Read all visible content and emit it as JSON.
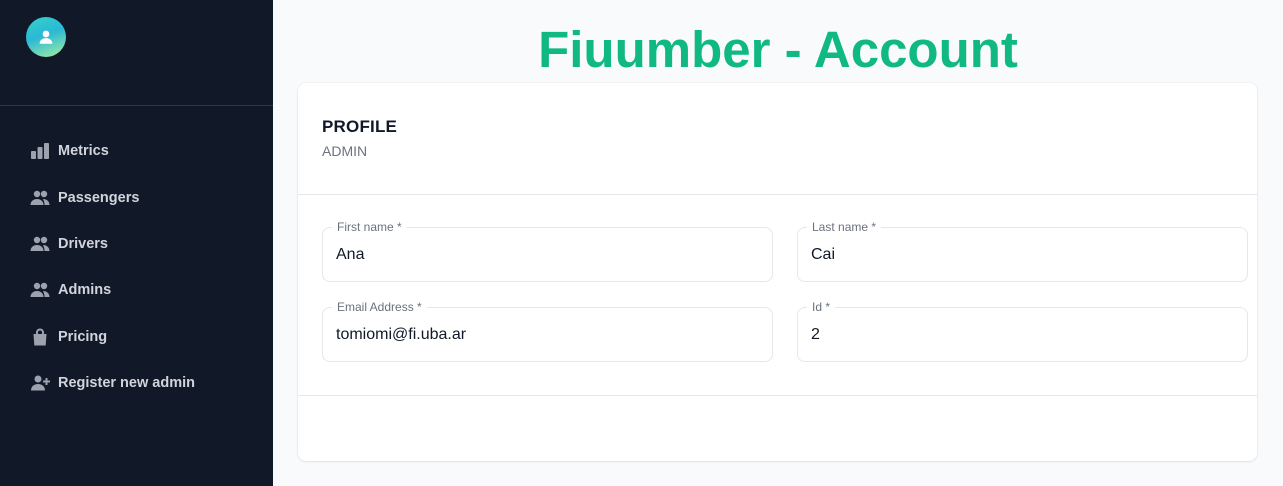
{
  "header": {
    "title": "Fiuumber - Account"
  },
  "sidebar": {
    "items": [
      {
        "label": "Metrics",
        "icon": "bar-chart-icon"
      },
      {
        "label": "Passengers",
        "icon": "users-icon"
      },
      {
        "label": "Drivers",
        "icon": "users-icon"
      },
      {
        "label": "Admins",
        "icon": "users-icon"
      },
      {
        "label": "Pricing",
        "icon": "shopping-bag-icon"
      },
      {
        "label": "Register new admin",
        "icon": "user-add-icon"
      }
    ]
  },
  "profile": {
    "title": "PROFILE",
    "subtitle": "ADMIN",
    "fields": {
      "first_name": {
        "label": "First name *",
        "value": "Ana"
      },
      "last_name": {
        "label": "Last name *",
        "value": "Cai"
      },
      "email": {
        "label": "Email Address *",
        "value": "tomiomi@fi.uba.ar"
      },
      "id": {
        "label": "Id *",
        "value": "2"
      }
    }
  },
  "colors": {
    "sidebar_bg": "#111827",
    "title_green": "#10b981",
    "page_bg": "#f9fafc"
  }
}
